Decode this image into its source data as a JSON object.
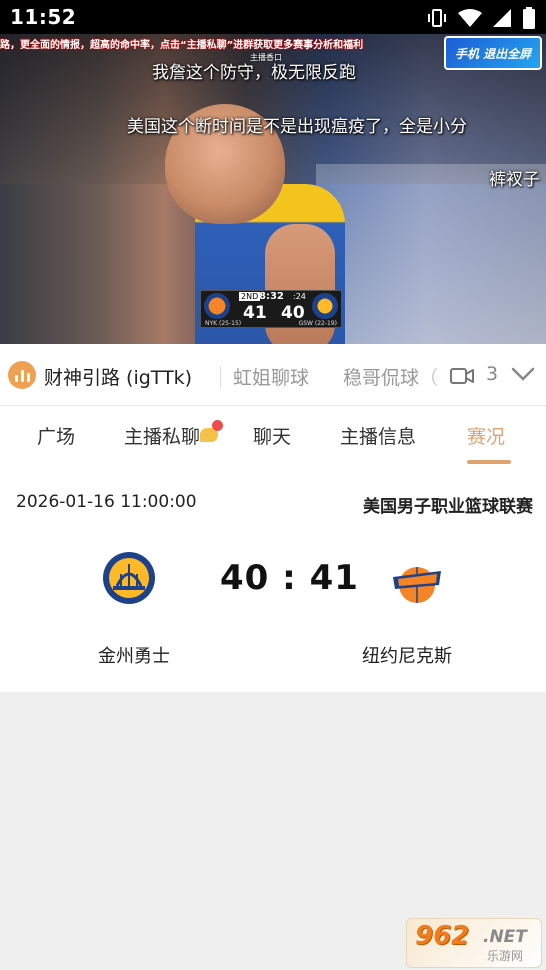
{
  "status_bar": {
    "time": "11:52"
  },
  "video": {
    "ticker": "路，更全面的情报，超高的命中率，点击“主播私聊”进群获取更多赛事分析和福利",
    "ticker_sub": "主播香口",
    "logo_text": "手机 退出全屏",
    "danmaku": [
      "我詹这个防守，极无限反跑",
      "美国这个断时间是不是出现瘟疫了，全是小分",
      "裤衩子"
    ],
    "scoreboard": {
      "period": "2ND",
      "clock": "8:32",
      "shot_clock": ":24",
      "left_score": "41",
      "right_score": "40",
      "left_team": "NYK",
      "right_team": "GSW",
      "left_record": "(25-15)",
      "right_record": "(22-19)"
    }
  },
  "anchor_bar": {
    "items": [
      "财神引路 (igTTk)",
      "虹姐聊球",
      "稳哥侃球（"
    ],
    "video_count": "3"
  },
  "tabs": [
    "广场",
    "主播私聊",
    "聊天",
    "主播信息",
    "赛况"
  ],
  "active_tab": "赛况",
  "match": {
    "datetime": "2026-01-16 11:00:00",
    "league": "美国男子职业篮球联赛",
    "score": "40 : 41",
    "home_team": "金州勇士",
    "away_team": "纽约尼克斯"
  },
  "watermark": {
    "main": "962",
    "net": ".NET",
    "sub": "乐游网"
  },
  "colors": {
    "accent": "#e0a36e",
    "badge": "#f04b4b"
  }
}
